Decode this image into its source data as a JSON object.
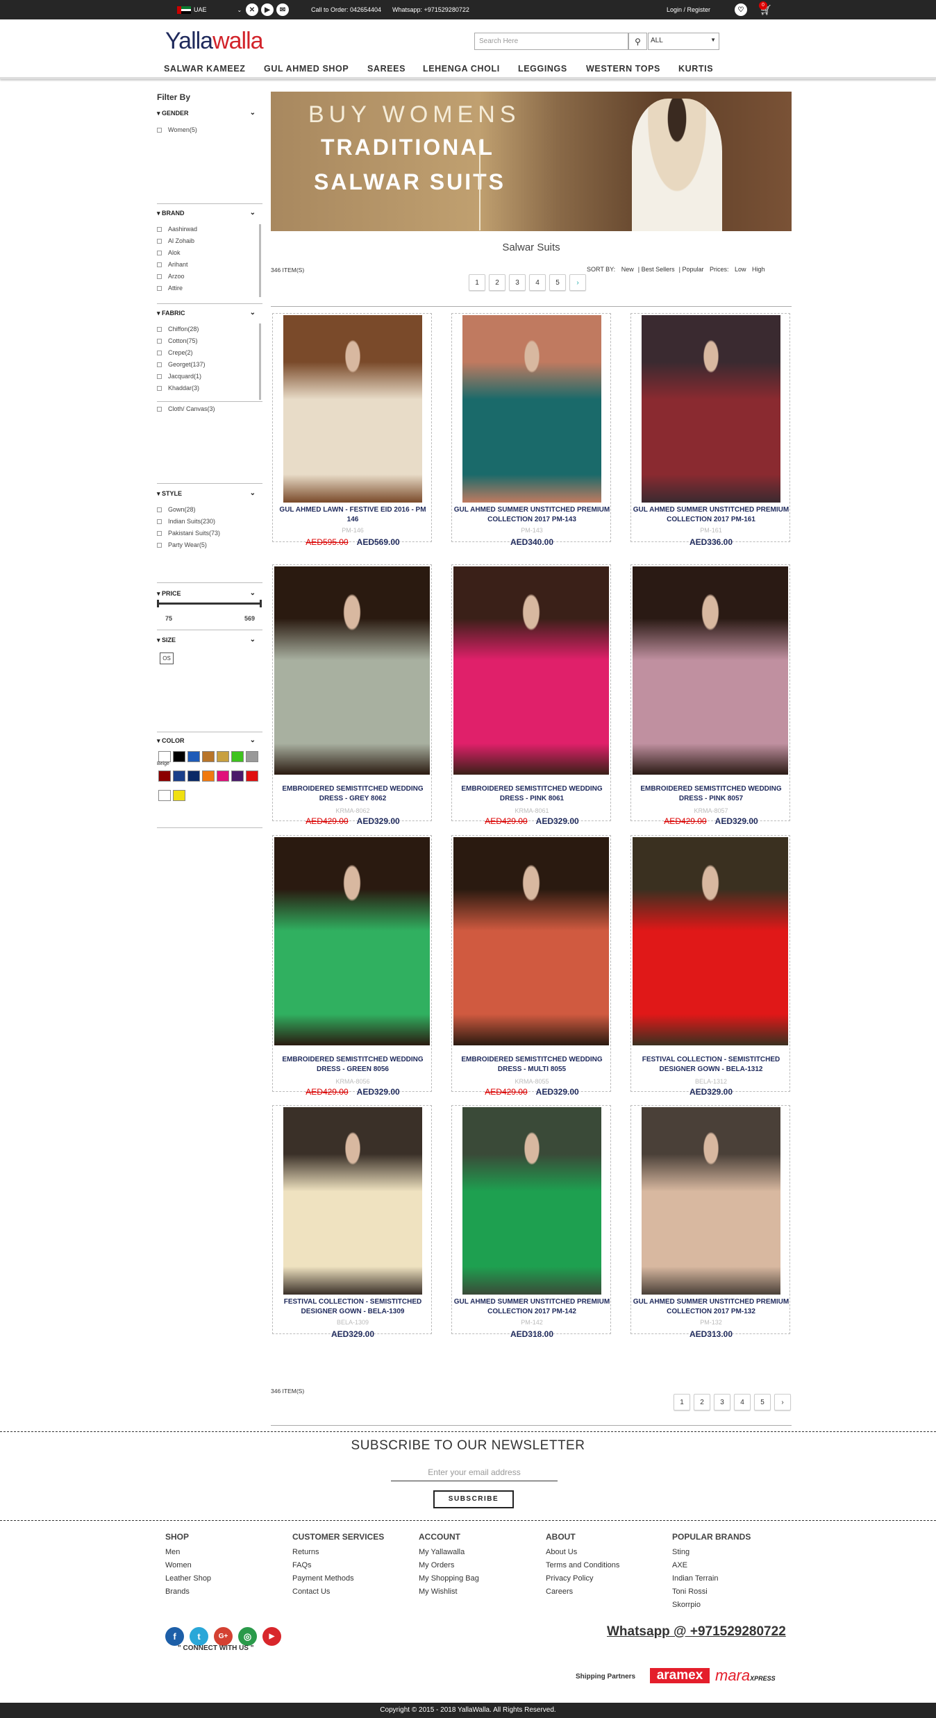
{
  "topbar": {
    "country": "UAE",
    "call": "Call to Order: 042654404",
    "whatsapp": "Whatsapp: +971529280722",
    "login": "Login / Register",
    "cart_count": "0"
  },
  "header": {
    "logo_a": "Yalla",
    "logo_b": "walla",
    "search_placeholder": "Search Here",
    "category": "ALL"
  },
  "nav": [
    "SALWAR KAMEEZ",
    "GUL AHMED SHOP",
    "SAREES",
    "LEHENGA CHOLI",
    "LEGGINGS",
    "WESTERN TOPS",
    "KURTIS"
  ],
  "filters": {
    "title": "Filter By",
    "gender": {
      "label": "GENDER",
      "items": [
        "Women(5)"
      ]
    },
    "brand": {
      "label": "BRAND",
      "items": [
        "Aashirwad",
        "Al Zohaib",
        "Alok",
        "Arihant",
        "Arzoo",
        "Attire"
      ]
    },
    "fabric": {
      "label": "FABRIC",
      "items": [
        "Chiffon(28)",
        "Cotton(75)",
        "Crepe(2)",
        "Georget(137)",
        "Jacquard(1)",
        "Khaddar(3)",
        "Cloth/ Canvas(3)"
      ]
    },
    "style": {
      "label": "STYLE",
      "items": [
        "Gown(28)",
        "Indian Suits(230)",
        "Pakistani Suits(73)",
        "Party Wear(5)"
      ]
    },
    "price": {
      "label": "PRICE",
      "min": "75",
      "max": "569",
      "range_fraction": [
        0,
        1
      ]
    },
    "size": {
      "label": "SIZE",
      "items": [
        "OS"
      ]
    },
    "color": {
      "label": "COLOR",
      "swatches": [
        "#ffffff",
        "#000000",
        "#1e5bb8",
        "#b8752a",
        "#c8a040",
        "#3ec31e",
        "#999999",
        "#8b0000",
        "#1a3f8a",
        "#0a2a66",
        "#f07a10",
        "#e0107a",
        "#4a1a6a",
        "#e01010",
        "#ffffff",
        "#f0e010"
      ],
      "note": "Beige"
    }
  },
  "banner": {
    "line1": "BUY WOMENS",
    "line2": "TRADITIONAL",
    "line3": "SALWAR SUITS"
  },
  "page_title": "Salwar Suits",
  "items_count": "346 ITEM(S)",
  "sort": {
    "label": "SORT BY:",
    "options": [
      "New",
      "Best Sellers",
      "Popular",
      "Prices:",
      "Low",
      "High"
    ]
  },
  "pager": [
    "1",
    "2",
    "3",
    "4",
    "5",
    "›"
  ],
  "products": [
    {
      "name": "GUL AHMED LAWN - FESTIVE EID 2016 - PM 146",
      "code": "PM-146",
      "old": "AED595.00",
      "price": "AED569.00",
      "c1": "#7a4a2a",
      "c2": "#e8dcc8"
    },
    {
      "name": "GUL AHMED SUMMER UNSTITCHED PREMIUM COLLECTION 2017 PM-143",
      "code": "PM-143",
      "old": "",
      "price": "AED340.00",
      "c1": "#c07a60",
      "c2": "#1a6a6a"
    },
    {
      "name": "GUL AHMED SUMMER UNSTITCHED PREMIUM COLLECTION 2017 PM-161",
      "code": "PM-161",
      "old": "",
      "price": "AED336.00",
      "c1": "#3a2a30",
      "c2": "#8a2a30"
    },
    {
      "name": "EMBROIDERED SEMISTITCHED WEDDING DRESS - GREY 8062",
      "code": "KRMA-8062",
      "old": "AED429.00",
      "price": "AED329.00",
      "c1": "#2a1a10",
      "c2": "#a8b0a0"
    },
    {
      "name": "EMBROIDERED SEMISTITCHED WEDDING DRESS - PINK 8061",
      "code": "KRMA-8061",
      "old": "AED429.00",
      "price": "AED329.00",
      "c1": "#3a2018",
      "c2": "#e0206a"
    },
    {
      "name": "EMBROIDERED SEMISTITCHED WEDDING DRESS - PINK 8057",
      "code": "KRMA-8057",
      "old": "AED429.00",
      "price": "AED329.00",
      "c1": "#2a1a14",
      "c2": "#c090a0"
    },
    {
      "name": "EMBROIDERED SEMISTITCHED WEDDING DRESS - GREEN 8056",
      "code": "KRMA-8056",
      "old": "AED429.00",
      "price": "AED329.00",
      "c1": "#2a1a10",
      "c2": "#30b060"
    },
    {
      "name": "EMBROIDERED SEMISTITCHED WEDDING DRESS - MULTI 8055",
      "code": "KRMA-8055",
      "old": "AED429.00",
      "price": "AED329.00",
      "c1": "#2a1a10",
      "c2": "#d05a40"
    },
    {
      "name": "FESTIVAL COLLECTION - SEMISTITCHED DESIGNER GOWN - BELA-1312",
      "code": "BELA-1312",
      "old": "",
      "price": "AED329.00",
      "c1": "#3a3020",
      "c2": "#e01818"
    },
    {
      "name": "FESTIVAL COLLECTION - SEMISTITCHED DESIGNER GOWN - BELA-1309",
      "code": "BELA-1309",
      "old": "",
      "price": "AED329.00",
      "c1": "#3a3028",
      "c2": "#efe2c0"
    },
    {
      "name": "GUL AHMED SUMMER UNSTITCHED PREMIUM COLLECTION 2017 PM-142",
      "code": "PM-142",
      "old": "",
      "price": "AED318.00",
      "c1": "#3a4a38",
      "c2": "#1ea050"
    },
    {
      "name": "GUL AHMED SUMMER UNSTITCHED PREMIUM COLLECTION 2017 PM-132",
      "code": "PM-132",
      "old": "",
      "price": "AED313.00",
      "c1": "#4a4038",
      "c2": "#d8b8a0"
    }
  ],
  "newsletter": {
    "title": "SUBSCRIBE TO OUR NEWSLETTER",
    "placeholder": "Enter your email address",
    "button": "SUBSCRIBE"
  },
  "footer": {
    "shop": {
      "h": "SHOP",
      "items": [
        "Men",
        "Women",
        "Leather Shop",
        "Brands"
      ]
    },
    "cs": {
      "h": "CUSTOMER SERVICES",
      "items": [
        "Returns",
        "FAQs",
        "Payment Methods",
        "Contact Us"
      ]
    },
    "account": {
      "h": "ACCOUNT",
      "items": [
        "My Yallawalla",
        "My Orders",
        "My Shopping Bag",
        "My Wishlist"
      ]
    },
    "about": {
      "h": "ABOUT",
      "items": [
        "About Us",
        "Terms and Conditions",
        "Privacy Policy",
        "Careers"
      ]
    },
    "brands": {
      "h": "POPULAR BRANDS",
      "items": [
        "Sting",
        "AXE",
        "Indian Terrain",
        "Toni Rossi",
        "Skorrpio"
      ]
    },
    "connect": "\" CONNECT WITH US \"",
    "whatsapp": "Whatsapp @ +971529280722",
    "shipping": "Shipping Partners",
    "aramex": "aramex",
    "mara": "mara",
    "mara_sub": "XPRESS",
    "copyright": "Copyright © 2015 - 2018 YallaWalla. All Rights Reserved."
  }
}
